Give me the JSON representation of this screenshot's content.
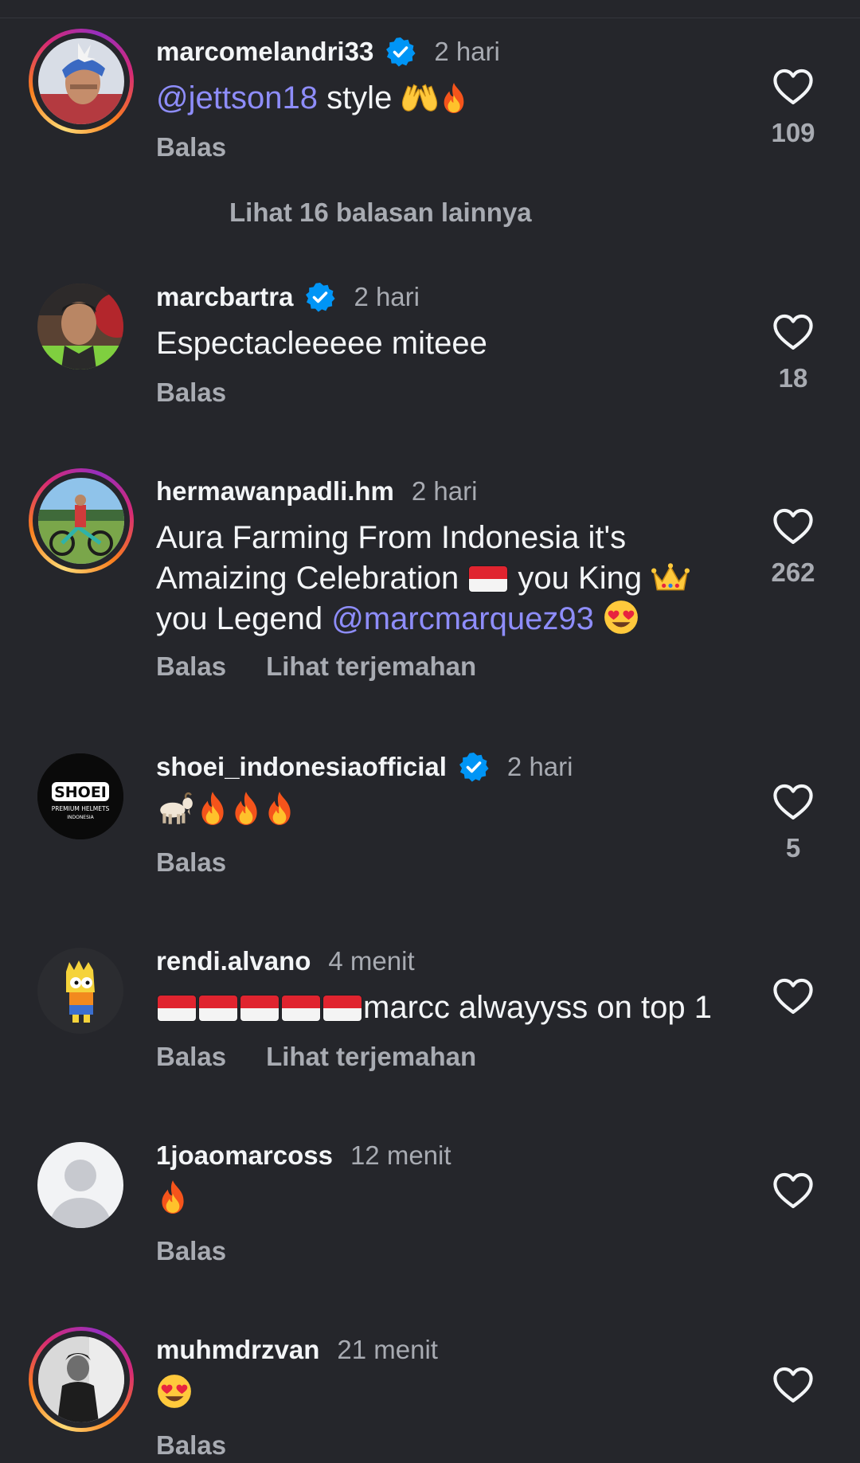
{
  "more_replies_label": "Lihat 16 balasan lainnya",
  "colors": {
    "background": "#25262b",
    "secondary_text": "#a8abb2",
    "mention": "#8e8dfb",
    "verified": "#0095f6"
  },
  "comments": [
    {
      "username": "marcomelandri33",
      "verified": true,
      "time": "2 hari",
      "mention": "@jettson18",
      "text": " style",
      "emojis": "raising-hands, fire",
      "reply_label": "Balas",
      "likes": "109"
    },
    {
      "username": "marcbartra",
      "verified": true,
      "time": "2 hari",
      "text": "Espectacleeeee miteee",
      "reply_label": "Balas",
      "likes": "18"
    },
    {
      "username": "hermawanpadli.hm",
      "verified": false,
      "time": "2 hari",
      "text_1": "Aura Farming From Indonesia it's",
      "text_2a": "Amaizing Celebration ",
      "text_2b": " you King ",
      "text_3a": "you Legend ",
      "mention": "@marcmarquez93",
      "reply_label": "Balas",
      "translate_label": "Lihat terjemahan",
      "likes": "262"
    },
    {
      "username": "shoei_indonesiaofficial",
      "verified": true,
      "time": "2 hari",
      "avatar_logo": "SHOEI",
      "avatar_sub": "PREMIUM HELMETS",
      "avatar_sub2": "INDONESIA",
      "emojis": "goat, fire, fire, fire",
      "reply_label": "Balas",
      "likes": "5"
    },
    {
      "username": "rendi.alvano",
      "verified": false,
      "time": "4 menit",
      "text": "marcc alwayyss on top 1",
      "reply_label": "Balas",
      "translate_label": "Lihat terjemahan",
      "likes": ""
    },
    {
      "username": "1joaomarcoss",
      "verified": false,
      "time": "12 menit",
      "emojis": "fire",
      "reply_label": "Balas",
      "likes": ""
    },
    {
      "username": "muhmdrzvan",
      "verified": false,
      "time": "21 menit",
      "emojis": "heart-eyes",
      "reply_label": "Balas",
      "likes": ""
    }
  ]
}
